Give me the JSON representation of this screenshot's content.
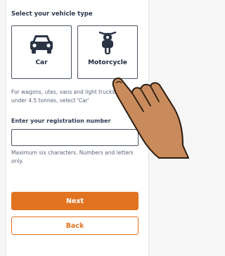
{
  "vehicle_type": {
    "heading": "Select your vehicle type",
    "options": [
      {
        "label": "Car",
        "icon": "car-icon",
        "selected": false
      },
      {
        "label": "Motorcycle",
        "icon": "motorcycle-icon",
        "selected": false
      }
    ],
    "hint": "For wagons, utes, vans and light trucks under 4.5 tonnes, select 'Car'"
  },
  "registration": {
    "label": "Enter your registration number",
    "value": "",
    "placeholder": "",
    "hint": "Maximum six characters. Numbers and letters only."
  },
  "actions": {
    "next_label": "Next",
    "back_label": "Back"
  },
  "colors": {
    "accent": "#e27321",
    "heading": "#2f3a52",
    "card_border": "#4a5360",
    "hint_text": "#5b6575",
    "hand_skin": "#c98b5b"
  }
}
